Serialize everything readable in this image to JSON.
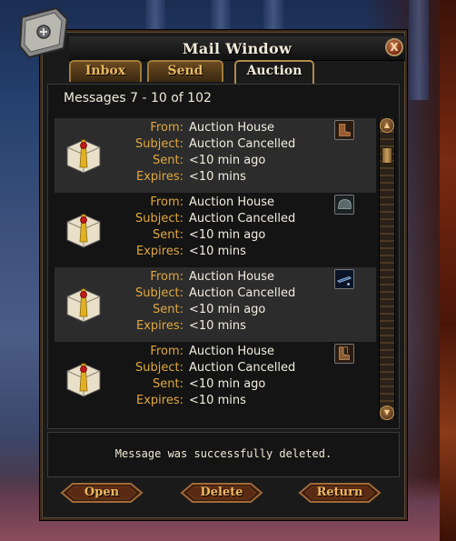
{
  "window": {
    "title": "Mail Window",
    "close_glyph": "X",
    "emblem_icon": "scroll-emblem-icon"
  },
  "tabs": [
    {
      "label": "Inbox",
      "active": false
    },
    {
      "label": "Send",
      "active": false
    },
    {
      "label": "Auction",
      "active": true
    }
  ],
  "list": {
    "header": "Messages 7 - 10 of 102",
    "field_labels": {
      "from": "From:",
      "subject": "Subject:",
      "sent": "Sent:",
      "expires": "Expires:"
    },
    "messages": [
      {
        "from": "Auction House",
        "subject": "Auction Cancelled",
        "sent": "<10 min ago",
        "expires": "<10 mins",
        "item_icon": "boots-item-icon",
        "item_color": "#9a5a30"
      },
      {
        "from": "Auction House",
        "subject": "Auction Cancelled",
        "sent": "<10 min ago",
        "expires": "<10 mins",
        "item_icon": "helmet-item-icon",
        "item_color": "#5a6a6a"
      },
      {
        "from": "Auction House",
        "subject": "Auction Cancelled",
        "sent": "<10 min ago",
        "expires": "<10 mins",
        "item_icon": "blade-item-icon",
        "item_color": "#1a2a4a"
      },
      {
        "from": "Auction House",
        "subject": "Auction Cancelled",
        "sent": "<10 min ago",
        "expires": "<10 mins",
        "item_icon": "boots-item-icon",
        "item_color": "#8a5a30"
      }
    ]
  },
  "status": {
    "message": "Message was successfully deleted."
  },
  "buttons": {
    "open": "Open",
    "delete": "Delete",
    "return": "Return"
  },
  "colors": {
    "label": "#e0a840",
    "value": "#f2ede0",
    "accent": "#a07a3a"
  }
}
